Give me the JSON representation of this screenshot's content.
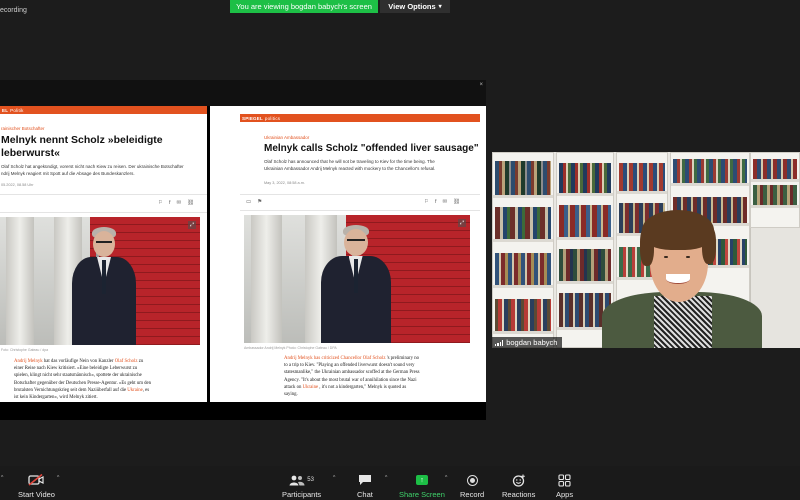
{
  "top": {
    "recording_label": "ecording",
    "viewing_banner": "You are viewing bogdan babych's screen",
    "view_options": "View Options",
    "view_options_chevron": "▾"
  },
  "left_article": {
    "brand": "EL",
    "section": "Politik",
    "kicker": "rainischer Botschafter",
    "headline_line1": "Melnyk nennt Scholz »beleidigte",
    "headline_line2": "leberwurst«",
    "standfirst_line1": "Olaf Scholz hat angekündigt, vorerst nicht nach Kiew zu reisen. Der ukrainische Botschafter",
    "standfirst_line2": "ndrij Melnyk reagiert mit Spott auf die Absage des Bundeskanzlers.",
    "meta": "05.2022, 08.58 Uhr",
    "caption": "Foto: Christophe Gateau / dpa",
    "body_link1": "Andrij Melnyk",
    "body_1a": " hat das vorläufige Nein von Kanzler ",
    "body_link2": "Olaf Scholz",
    "body_1b": " zu",
    "body_2": "einer Reise nach Kiew kritisiert. »Eine beleidigte Leberwurst zu",
    "body_3": "spielen, klingt nicht sehr staatsmännisch«, spottete der ukrainische",
    "body_4": "Botschafter gegenüber der Deutschen Presse-Agentur. »Es geht um den",
    "body_5a": "brutalsten Vernichtungskrieg seit dem Nazi­überfall auf die ",
    "body_link3": "Ukraine",
    "body_5b": ", es",
    "body_6": "ist kein Kindergarten«, wird Melnyk zitiert."
  },
  "right_article": {
    "brand": "SPIEGEL",
    "section": "politics",
    "kicker": "Ukrainian Ambassador",
    "headline": "Melnyk calls Scholz \"offended liver sausage\"",
    "standfirst_line1": "Olaf Scholz has announced that he will not be traveling to Kiev for the time being. The",
    "standfirst_line2": "Ukrainian Ambassador Andrij Melnyk reacted with mockery to the Chancellor's refusal.",
    "meta": "May 3, 2022, 08:58 a.m.",
    "caption": "Ambassador Andrij Melnyk   Photo: Christophe Gateau / DPA",
    "body_link1": "Andrij Melnyk has criticized Chancellor Olaf Scholz",
    "body_1b": " 's preliminary no",
    "body_2": "to a trip to Kiev. \"Playing an offended liverwurst doesn't sound very",
    "body_3": "statesmanlike,\" the Ukrainian ambassador scoffed at the German Press",
    "body_4": "Agency. \"It's about the most brutal war of annihilation since the Nazi",
    "body_5a": "attack on ",
    "body_link2": "Ukraine",
    "body_5b": " , it's not a kindergarten,\" Melnyk is quoted as",
    "body_6": "saying."
  },
  "share_close": "×",
  "participant": {
    "name": "bogdan babych"
  },
  "toolbar": {
    "start_video": "Start Video",
    "participants": "Participants",
    "participants_count": "53",
    "chat": "Chat",
    "share_screen": "Share Screen",
    "record": "Record",
    "reactions": "Reactions",
    "apps": "Apps",
    "caret": "^",
    "share_glyph": "↑"
  },
  "colors": {
    "background": "#1c1c1c",
    "banner_green": "#1dbf46",
    "spiegel_orange": "#e2521f"
  }
}
